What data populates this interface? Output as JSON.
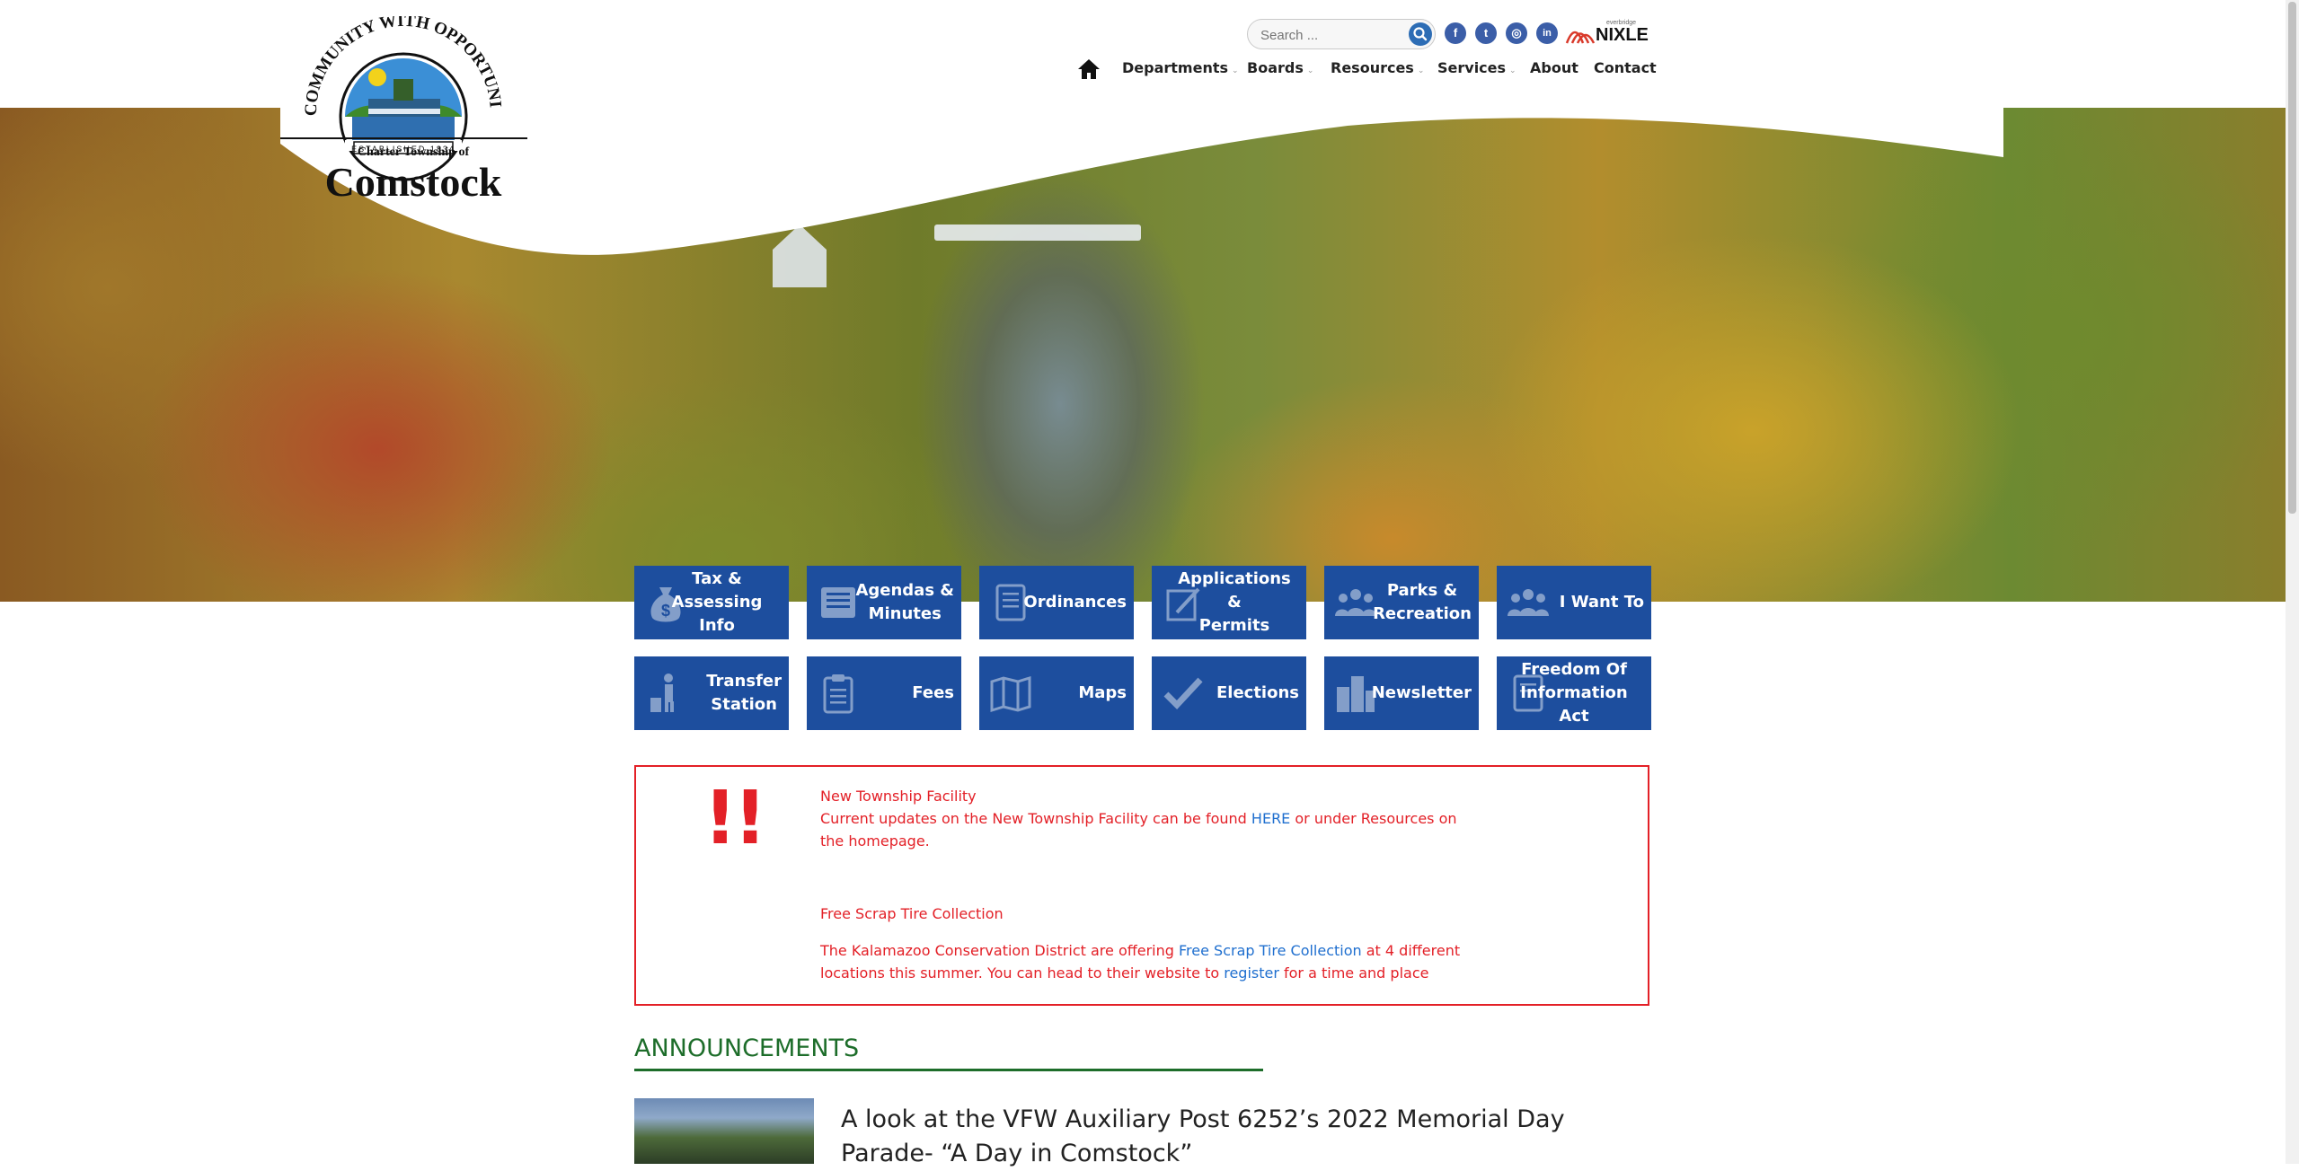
{
  "header": {
    "logo": {
      "arc_text": "A COMMUNITY WITH OPPORTUNITY",
      "established": "ESTABLISHED 1834",
      "subtitle": "Charter Township of",
      "name": "Comstock"
    },
    "search": {
      "placeholder": "Search ..."
    },
    "social": [
      {
        "icon": "facebook-icon",
        "glyph": "f"
      },
      {
        "icon": "twitter-icon",
        "glyph": "t"
      },
      {
        "icon": "instagram-icon",
        "glyph": "◎"
      },
      {
        "icon": "linkedin-icon",
        "glyph": "in"
      }
    ],
    "nixle": {
      "small": "everbridge",
      "label": "NIXLE"
    },
    "nav": [
      {
        "label": "Departments",
        "has_dropdown": true
      },
      {
        "label": "Boards",
        "has_dropdown": true
      },
      {
        "label": "Resources",
        "has_dropdown": true
      },
      {
        "label": "Services",
        "has_dropdown": true
      },
      {
        "label": "About",
        "has_dropdown": false
      },
      {
        "label": "Contact",
        "has_dropdown": false
      }
    ]
  },
  "tiles": [
    {
      "lines": [
        "Tax & Assessing",
        "Info"
      ],
      "icon": "money-bag-icon"
    },
    {
      "lines": [
        "Agendas &",
        "Minutes"
      ],
      "icon": "newspaper-icon"
    },
    {
      "lines": [
        "Ordinances"
      ],
      "icon": "document-icon"
    },
    {
      "lines": [
        "Applications &",
        "Permits"
      ],
      "icon": "signing-document-icon"
    },
    {
      "lines": [
        "Parks &",
        "Recreation"
      ],
      "icon": "people-group-icon"
    },
    {
      "lines": [
        "I Want To"
      ],
      "icon": "people-group-icon"
    },
    {
      "lines": [
        "Transfer",
        "Station"
      ],
      "icon": "person-trash-icon"
    },
    {
      "lines": [
        "Fees"
      ],
      "icon": "clipboard-icon"
    },
    {
      "lines": [
        "Maps"
      ],
      "icon": "map-icon"
    },
    {
      "lines": [
        "Elections"
      ],
      "icon": "checkmark-icon"
    },
    {
      "lines": [
        "Newsletter"
      ],
      "icon": "buildings-icon"
    },
    {
      "lines": [
        "Freedom Of",
        "Information Act"
      ],
      "icon": "document-icon"
    }
  ],
  "alert": {
    "symbol": "!!",
    "facility_title": "New Township Facility",
    "facility_text_before": "Current updates on the New Township Facility can be found ",
    "facility_link": "HERE",
    "facility_text_after": "  or under Resources on the homepage.",
    "tire_title": "Free Scrap Tire Collection",
    "tire_text_before": "The Kalamazoo Conservation District are offering ",
    "tire_link": "Free Scrap Tire Collection",
    "tire_text_middle": " at 4 different locations this summer. You can head to their website to ",
    "tire_link2": "register",
    "tire_text_after": " for a time and place"
  },
  "announcements": {
    "title": "ANNOUNCEMENTS",
    "items": [
      {
        "headline": "A look at the VFW Auxiliary Post 6252’s 2022 Memorial Day Parade- “A Day in Comstock”"
      }
    ]
  },
  "colors": {
    "tile_blue": "#1d4e9e",
    "alert_red": "#e32027",
    "link_blue": "#1f6fcf",
    "heading_green": "#1d6d2a"
  }
}
